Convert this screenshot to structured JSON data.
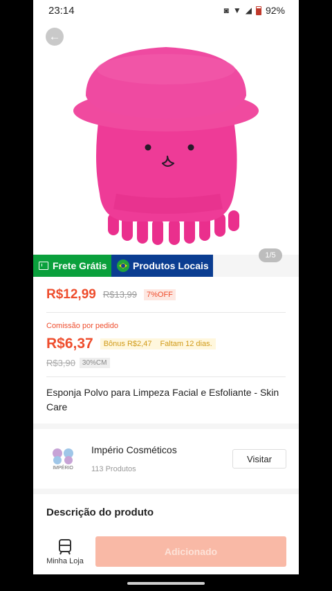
{
  "status_bar": {
    "time": "23:14",
    "battery": "92%"
  },
  "product": {
    "image_counter": "1/5",
    "badges": {
      "frete": "Frete Grátis",
      "locais": "Produtos Locais"
    },
    "price": "R$12,99",
    "old_price": "R$13,99",
    "discount": "7%OFF",
    "commission_label": "Comissão por pedido",
    "commission_value": "R$6,37",
    "bonus": "Bônus R$2,47",
    "days_left": "Faltam 12 dias.",
    "cm_old": "R$3,90",
    "cm_rate": "30%CM",
    "title": "Esponja Polvo para Limpeza Facial e Esfoliante - Skin Care"
  },
  "store": {
    "logo_text": "IMPÉRIO",
    "name": "Império Cosméticos",
    "products": "113 Produtos",
    "visit_label": "Visitar"
  },
  "description": {
    "title": "Descrição do produto"
  },
  "bottom_bar": {
    "store_tab": "Minha Loja",
    "add_label": "Adicionado"
  },
  "colors": {
    "accent": "#ee4d2d",
    "frete": "#0aa03c",
    "locais": "#0b3d91",
    "product_pink": "#ee3b97"
  }
}
